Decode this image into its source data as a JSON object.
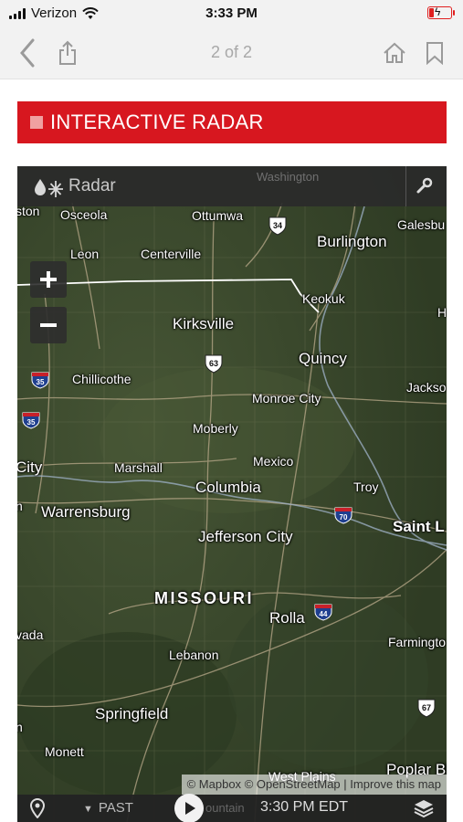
{
  "status_bar": {
    "carrier": "Verizon",
    "time": "3:33 PM"
  },
  "nav": {
    "page_indicator": "2 of 2"
  },
  "section": {
    "title": "INTERACTIVE RADAR"
  },
  "colors": {
    "brand_red": "#d7171f",
    "battery_red": "#e02020",
    "map_green": "#3b4a2e"
  },
  "map": {
    "layer_label": "Radar",
    "top_ghost_label": "Washington",
    "zoom_in_symbol": "+",
    "zoom_out_symbol": "−",
    "cities": {
      "ston": "ston",
      "osceola": "Osceola",
      "ottumwa": "Ottumwa",
      "galesburg": "Galesbu",
      "burlington": "Burlington",
      "leon": "Leon",
      "centerville": "Centerville",
      "keokuk": "Keokuk",
      "h": "H",
      "kirksville": "Kirksville",
      "quincy": "Quincy",
      "chillicothe": "Chillicothe",
      "jackson": "Jackso",
      "monroe_city": "Monroe City",
      "moberly": "Moberly",
      "mexico": "Mexico",
      "marshall": "Marshall",
      "city": "City",
      "columbia": "Columbia",
      "troy": "Troy",
      "warrensburg": "Warrensburg",
      "n1": "n",
      "saint_l": "Saint L",
      "jefferson_city": "Jefferson City",
      "missouri": "MISSOURI",
      "rolla": "Rolla",
      "vada": "vada",
      "farmington": "Farmingto",
      "lebanon": "Lebanon",
      "springfield": "Springfield",
      "n2": "n",
      "monett": "Monett",
      "west_plains": "West Plains",
      "poplar_bluff": "Poplar Bl"
    },
    "highways": {
      "i34": "34",
      "i63": "63",
      "i35a": "35",
      "i35b": "35",
      "i70": "70",
      "i44": "44",
      "i67": "67"
    },
    "attribution": {
      "mapbox": "© Mapbox",
      "osm": "© OpenStreetMap",
      "sep": "|",
      "improve": "Improve this map"
    },
    "bottom": {
      "past_label": "PAST",
      "time": "3:30 PM EDT",
      "ghost_label": "ountain"
    }
  }
}
